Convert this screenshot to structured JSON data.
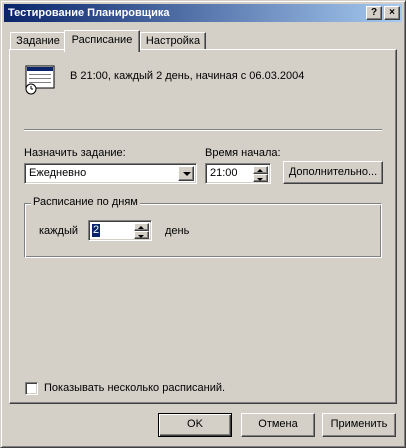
{
  "window": {
    "title": "Тестирование Планировщика",
    "help_button": "?",
    "close_button": "×"
  },
  "tabs": [
    {
      "label": "Задание",
      "active": false
    },
    {
      "label": "Расписание",
      "active": true
    },
    {
      "label": "Настройка",
      "active": false
    }
  ],
  "summary": {
    "icon": "schedule-calendar-clock-icon",
    "text": "В 21:00, каждый 2 день, начиная с 06.03.2004"
  },
  "schedule": {
    "assign_label": "Назначить задание:",
    "assign_value": "Ежедневно",
    "start_label": "Время начала:",
    "start_value": "21:00",
    "advanced_button": "Дополнительно..."
  },
  "daily_group": {
    "legend": "Расписание по дням",
    "every_label": "каждый",
    "every_value": "2",
    "unit_label": "день"
  },
  "multi_schedules": {
    "label": "Показывать несколько расписаний.",
    "checked": false
  },
  "buttons": {
    "ok": "OK",
    "cancel": "Отмена",
    "apply": "Применить"
  },
  "colors": {
    "titlebar_start": "#0a246a",
    "titlebar_end": "#a6caf0",
    "face": "#d4d0c8",
    "selection": "#0a246a"
  }
}
